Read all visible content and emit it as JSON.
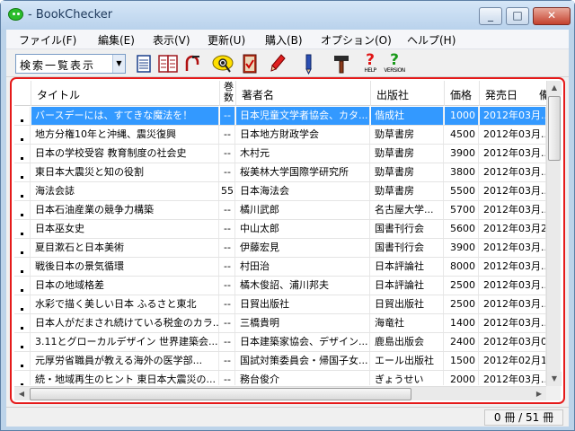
{
  "window": {
    "title": "- BookChecker"
  },
  "menu": [
    {
      "label": "ファイル(F)"
    },
    {
      "label": "編集(E)"
    },
    {
      "label": "表示(V)"
    },
    {
      "label": "更新(U)"
    },
    {
      "label": "購入(B)"
    },
    {
      "label": "オプション(O)"
    },
    {
      "label": "ヘルプ(H)"
    }
  ],
  "toolbar": {
    "view_select": "検索一覧表示",
    "help_label": "HELP",
    "version_label": "VERSION",
    "icons": [
      "list-view-icon",
      "detail-view-icon",
      "link-icon",
      "eye-search-icon",
      "check-icon",
      "red-pencil-icon",
      "blue-pencil-icon",
      "hammer-icon",
      "help-icon",
      "version-icon"
    ]
  },
  "grid": {
    "columns": {
      "title": "タイトル",
      "volume": "巻数",
      "author": "著者名",
      "publisher": "出版社",
      "price": "価格",
      "date": "発売日",
      "extra": "備"
    },
    "rows": [
      {
        "title": "バースデーには、すてきな魔法を！",
        "vol": "--",
        "author": "日本児童文学者協会、カタ...",
        "publisher": "偕成社",
        "price": "1000",
        "date": "2012年03月...",
        "selected": true
      },
      {
        "title": "地方分権10年と沖縄、震災復興",
        "vol": "--",
        "author": "日本地方財政学会",
        "publisher": "勁草書房",
        "price": "4500",
        "date": "2012年03月..."
      },
      {
        "title": "日本の学校受容 教育制度の社会史",
        "vol": "--",
        "author": "木村元",
        "publisher": "勁草書房",
        "price": "3900",
        "date": "2012年03月..."
      },
      {
        "title": "東日本大震災と知の役割",
        "vol": "--",
        "author": "桜美林大学国際学研究所",
        "publisher": "勁草書房",
        "price": "3800",
        "date": "2012年03月..."
      },
      {
        "title": "海法会誌",
        "vol": "55",
        "author": "日本海法会",
        "publisher": "勁草書房",
        "price": "5500",
        "date": "2012年03月..."
      },
      {
        "title": "日本石油産業の競争力構築",
        "vol": "--",
        "author": "橘川武郎",
        "publisher": "名古屋大学...",
        "price": "5700",
        "date": "2012年03月..."
      },
      {
        "title": "日本巫女史",
        "vol": "--",
        "author": "中山太郎",
        "publisher": "国書刊行会",
        "price": "5600",
        "date": "2012年03月2..."
      },
      {
        "title": "夏目漱石と日本美術",
        "vol": "--",
        "author": "伊藤宏見",
        "publisher": "国書刊行会",
        "price": "3900",
        "date": "2012年03月..."
      },
      {
        "title": "戦後日本の景気循環",
        "vol": "--",
        "author": "村田治",
        "publisher": "日本評論社",
        "price": "8000",
        "date": "2012年03月..."
      },
      {
        "title": "日本の地域格差",
        "vol": "--",
        "author": "橘木俊詔、浦川邦夫",
        "publisher": "日本評論社",
        "price": "2500",
        "date": "2012年03月..."
      },
      {
        "title": "水彩で描く美しい日本 ふるさと東北",
        "vol": "--",
        "author": "日貿出版社",
        "publisher": "日貿出版社",
        "price": "2500",
        "date": "2012年03月..."
      },
      {
        "title": "日本人がだまされ続けている税金のカラ...",
        "vol": "--",
        "author": "三橋貴明",
        "publisher": "海竜社",
        "price": "1400",
        "date": "2012年03月..."
      },
      {
        "title": "3.11とグローカルデザイン 世界建築会...",
        "vol": "--",
        "author": "日本建築家協会、デザイン...",
        "publisher": "鹿島出版会",
        "price": "2400",
        "date": "2012年03月0..."
      },
      {
        "title": "元厚労省職員が教える海外の医学部...",
        "vol": "--",
        "author": "国試対策委員会・帰国子女...",
        "publisher": "エール出版社",
        "price": "1500",
        "date": "2012年02月1..."
      },
      {
        "title": "続・地域再生のヒント 東日本大震災の...",
        "vol": "--",
        "author": "務台俊介",
        "publisher": "ぎょうせい",
        "price": "2000",
        "date": "2012年03月..."
      }
    ]
  },
  "status": {
    "count": "0 冊 / 51 冊"
  }
}
